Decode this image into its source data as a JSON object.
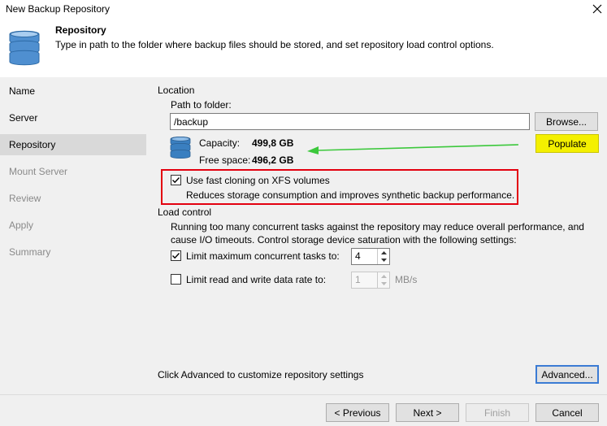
{
  "window": {
    "title": "New Backup Repository",
    "close_icon": "close-icon"
  },
  "header": {
    "title": "Repository",
    "description": "Type in path to the folder where backup files should be stored, and set repository load control options."
  },
  "sidebar": {
    "items": [
      {
        "label": "Name",
        "state": "enabled"
      },
      {
        "label": "Server",
        "state": "enabled"
      },
      {
        "label": "Repository",
        "state": "active"
      },
      {
        "label": "Mount Server",
        "state": "disabled"
      },
      {
        "label": "Review",
        "state": "disabled"
      },
      {
        "label": "Apply",
        "state": "disabled"
      },
      {
        "label": "Summary",
        "state": "disabled"
      }
    ]
  },
  "location": {
    "heading": "Location",
    "path_label": "Path to folder:",
    "path_value": "/backup",
    "browse_label": "Browse...",
    "populate_label": "Populate",
    "capacity_label": "Capacity:",
    "capacity_value": "499,8 GB",
    "free_label": "Free space:",
    "free_value": "496,2 GB"
  },
  "fast_clone": {
    "label": "Use fast cloning on XFS volumes",
    "checked": true,
    "note": "Reduces storage consumption and improves synthetic backup performance."
  },
  "load_control": {
    "heading": "Load control",
    "description_line1": "Running too many concurrent tasks against the repository may reduce overall performance, and",
    "description_line2": "cause I/O timeouts. Control storage device saturation with the following settings:",
    "limit_tasks_label": "Limit maximum concurrent tasks to:",
    "limit_tasks_checked": true,
    "limit_tasks_value": "4",
    "limit_rate_label": "Limit read and write data rate to:",
    "limit_rate_checked": false,
    "limit_rate_value": "1",
    "rate_unit": "MB/s"
  },
  "advanced": {
    "hint": "Click Advanced to customize repository settings",
    "button_label": "Advanced..."
  },
  "footer": {
    "previous_label": "< Previous",
    "next_label": "Next >",
    "finish_label": "Finish",
    "cancel_label": "Cancel"
  },
  "colors": {
    "accent_highlight": "#f4f000",
    "callout_border": "#e3000f",
    "arrow": "#3cc83c",
    "database_icon": "#3a7fc0"
  }
}
